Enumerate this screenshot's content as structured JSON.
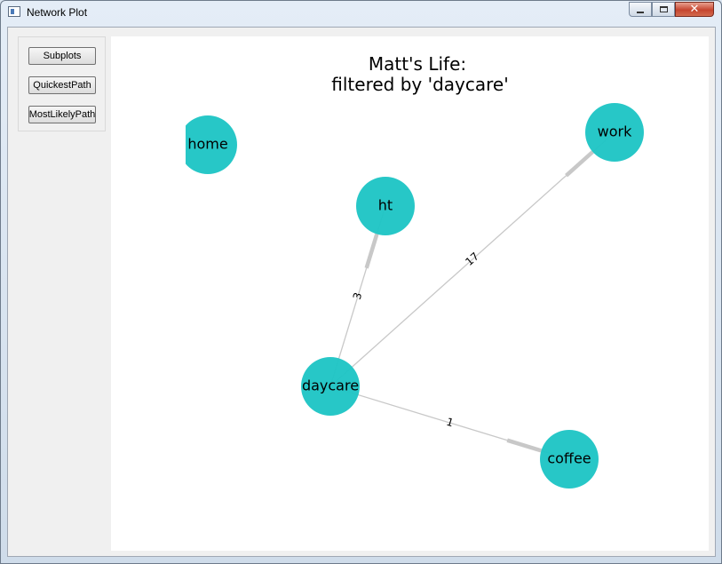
{
  "window": {
    "title": "Network Plot",
    "icon": "window-app-icon",
    "controls": [
      "minimize-icon",
      "maximize-icon",
      "close-icon"
    ]
  },
  "sidebar": {
    "buttons": [
      {
        "label": "Subplots"
      },
      {
        "label": "QuickestPath"
      },
      {
        "label": "MostLikelyPath"
      }
    ]
  },
  "plot": {
    "title_line1": "Matt's Life:",
    "title_line2": "filtered by 'daycare'",
    "node_color": "#1ec5c5",
    "edge_color": "#c8c8c8",
    "nodes": [
      {
        "id": "home",
        "label": "home"
      },
      {
        "id": "ht",
        "label": "ht"
      },
      {
        "id": "work",
        "label": "work"
      },
      {
        "id": "daycare",
        "label": "daycare"
      },
      {
        "id": "coffee",
        "label": "coffee"
      }
    ],
    "edges": [
      {
        "source": "daycare",
        "target": "ht",
        "label": "3"
      },
      {
        "source": "daycare",
        "target": "work",
        "label": "17"
      },
      {
        "source": "daycare",
        "target": "coffee",
        "label": "1"
      }
    ]
  }
}
